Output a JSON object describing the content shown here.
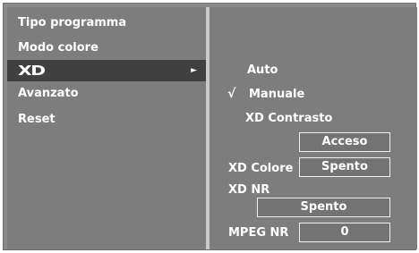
{
  "menu": {
    "items": [
      {
        "label": "Tipo programma"
      },
      {
        "label": "Modo colore"
      },
      {
        "label": "XD"
      },
      {
        "label": "Avanzato"
      },
      {
        "label": "Reset"
      }
    ],
    "submenu_arrow": "►"
  },
  "submenu": {
    "auto_label": "Auto",
    "check_mark": "√",
    "manuale_label": "Manuale",
    "xd_contrasto_label": "XD Contrasto",
    "xd_contrasto_value": "Acceso",
    "xd_colore_label": "XD Colore",
    "xd_colore_value": "Spento",
    "xd_nr_label": "XD NR",
    "xd_nr_value": "Spento",
    "mpeg_nr_label": "MPEG NR",
    "mpeg_nr_value": "0"
  },
  "colors": {
    "panel": "#7d7d7d",
    "selected": "#404040",
    "divider": "#c9c9c9",
    "text": "#ffffff"
  }
}
